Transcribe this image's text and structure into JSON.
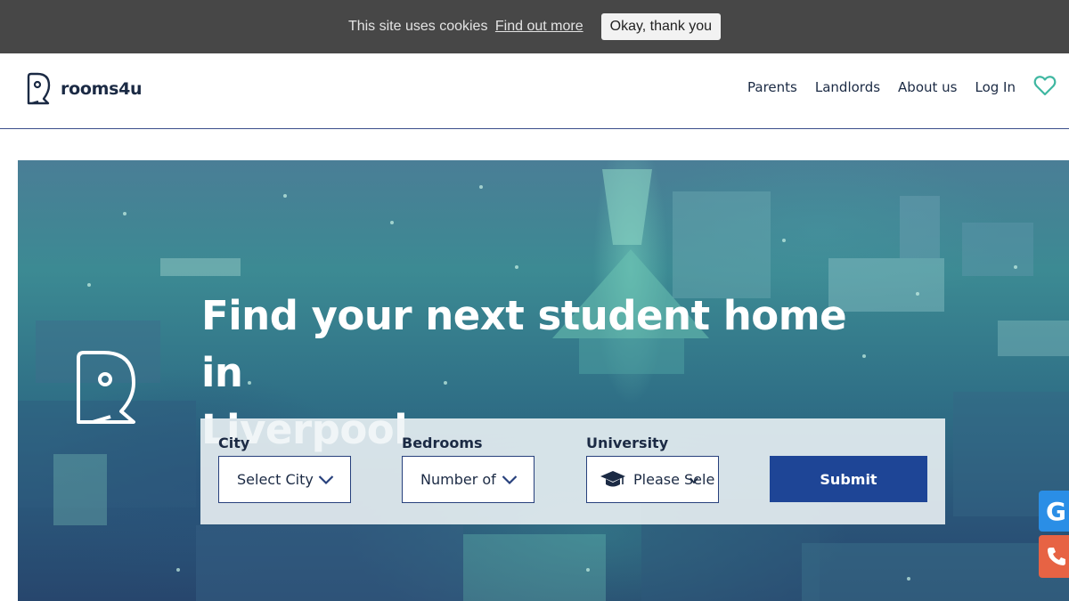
{
  "cookie_bar": {
    "text": "This site uses cookies",
    "link": "Find out more",
    "button": "Okay, thank you"
  },
  "header": {
    "logo_text": "rooms4u",
    "logo_icon": "map-pin-icon",
    "nav": [
      "Parents",
      "Landlords",
      "About us",
      "Log In"
    ],
    "favorites_icon": "heart-icon"
  },
  "hero": {
    "title_line1": "Find your next student home in",
    "title_line2": "Liverpool",
    "icon": "map-pin-icon"
  },
  "search": {
    "city_label": "City",
    "city_value": "Select City",
    "bedrooms_label": "Bedrooms",
    "bedrooms_value": "Number of",
    "university_label": "University",
    "university_value": "Please Sele",
    "university_icon": "graduation-cap-icon",
    "submit": "Submit"
  },
  "side_widgets": {
    "g_label": "G",
    "g_icon": "g-widget-icon",
    "phone_icon": "phone-icon"
  },
  "colors": {
    "cookie_bar": "#474747",
    "brand_navy": "#1b2a44",
    "submit_blue": "#1e4596",
    "heart_green": "#3fb7a1",
    "widget_blue": "#2a8ee6",
    "widget_orange": "#e76344"
  }
}
